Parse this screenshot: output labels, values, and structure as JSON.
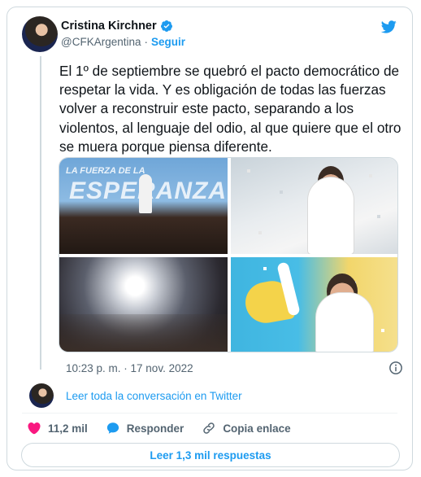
{
  "author": {
    "name": "Cristina Kirchner",
    "handle": "@CFKArgentina",
    "separator": "·",
    "follow_label": "Seguir"
  },
  "tweet": {
    "text": "El 1º de septiembre se quebró el pacto democrático de respetar la vida. Y es obligación de todas las fuerzas volver a reconstruir este pacto, separando a los violentos, al lenguaje del odio, al que quiere que el otro se muera porque piensa diferente.",
    "timestamp": "10:23 p. m. · 17 nov. 2022",
    "photo1_banner": "LA FUERZA DE LA",
    "photo1_big": "ESPERANZA"
  },
  "conversation": {
    "link_text": "Leer toda la conversación en Twitter"
  },
  "actions": {
    "likes": "11,2 mil",
    "reply_label": "Responder",
    "copy_label": "Copia enlace"
  },
  "read_replies": {
    "label": "Leer 1,3 mil respuestas"
  },
  "colors": {
    "accent": "#1d9bf0",
    "like": "#f91880",
    "text": "#0f1419",
    "muted": "#536471"
  },
  "icons": [
    "verified-badge-icon",
    "twitter-bird-icon",
    "info-icon",
    "heart-icon",
    "reply-bubble-icon",
    "link-icon"
  ]
}
